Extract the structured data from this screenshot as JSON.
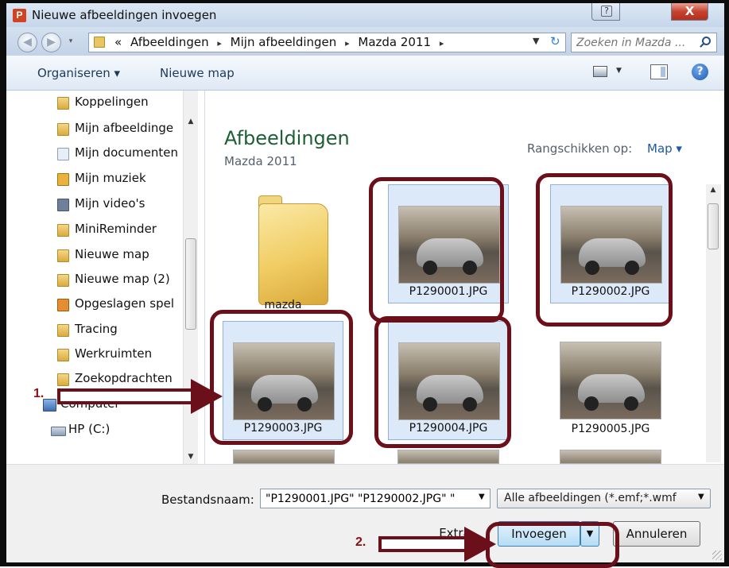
{
  "window": {
    "title": "Nieuwe afbeeldingen invoegen",
    "app_icon_letter": "P",
    "help_glyph": "?",
    "close_glyph": "X"
  },
  "address": {
    "prefix": "«",
    "crumbs": [
      "Afbeeldingen",
      "Mijn afbeeldingen",
      "Mazda 2011"
    ],
    "separator": "▸",
    "search_placeholder": "Zoeken in Mazda ..."
  },
  "toolbar": {
    "organize_label": "Organiseren ▾",
    "new_folder_label": "Nieuwe map",
    "help_glyph": "?"
  },
  "nav": {
    "items": [
      {
        "label": "Koppelingen",
        "icon": "folder-icon"
      },
      {
        "label": "Mijn afbeeldinge",
        "icon": "folder-icon"
      },
      {
        "label": "Mijn documenten",
        "icon": "doc-icon"
      },
      {
        "label": "Mijn muziek",
        "icon": "music-icon"
      },
      {
        "label": "Mijn video's",
        "icon": "video-icon"
      },
      {
        "label": "MiniReminder",
        "icon": "folder-icon"
      },
      {
        "label": "Nieuwe map",
        "icon": "folder-icon"
      },
      {
        "label": "Nieuwe map (2)",
        "icon": "folder-icon"
      },
      {
        "label": "Opgeslagen spel",
        "icon": "game-icon"
      },
      {
        "label": "Tracing",
        "icon": "folder-icon"
      },
      {
        "label": "Werkruimten",
        "icon": "folder-icon"
      },
      {
        "label": "Zoekopdrachten",
        "icon": "folder-icon"
      }
    ],
    "computer_label": "Computer",
    "drive_label": "HP (C:)"
  },
  "library": {
    "title": "Afbeeldingen",
    "subtitle": "Mazda 2011",
    "arrange_label": "Rangschikken op:",
    "arrange_value": "Map ▾"
  },
  "files": [
    {
      "name": "mazda",
      "type": "folder"
    },
    {
      "name": "P1290001.JPG",
      "type": "image",
      "selected": true
    },
    {
      "name": "P1290002.JPG",
      "type": "image",
      "selected": true
    },
    {
      "name": "P1290003.JPG",
      "type": "image",
      "selected": true
    },
    {
      "name": "P1290004.JPG",
      "type": "image",
      "selected": true
    },
    {
      "name": "P1290005.JPG",
      "type": "image",
      "selected": false
    }
  ],
  "bottom": {
    "filename_label": "Bestandsnaam:",
    "filename_value": "\"P1290001.JPG\" \"P1290002.JPG\" \"",
    "filter_value": "Alle afbeeldingen (*.emf;*.wmf",
    "extra_label": "Extra",
    "insert_label": "Invoegen",
    "cancel_label": "Annuleren"
  },
  "annotations": {
    "step1": "1.",
    "step2": "2."
  },
  "colors": {
    "annotation": "#6b0f1a",
    "selection": "#dce9f8",
    "library_title": "#1e5f35"
  }
}
